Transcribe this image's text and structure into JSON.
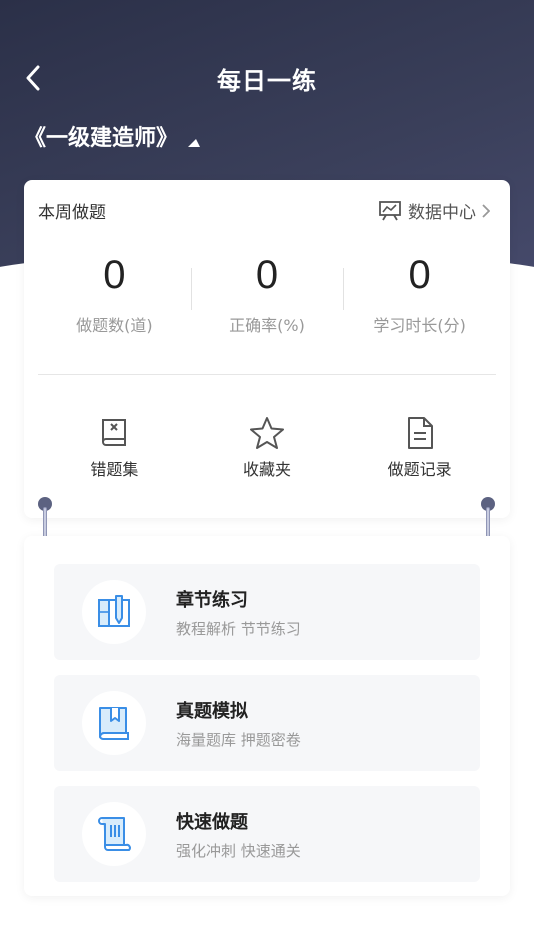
{
  "nav": {
    "title": "每日一练",
    "back_icon": "chevron-left-icon"
  },
  "exam": {
    "name": "《一级建造师》",
    "icon": "triangle-down-icon"
  },
  "weekly": {
    "title": "本周做题",
    "data_center_label": "数据中心",
    "stats": [
      {
        "value": "0",
        "label": "做题数(道)"
      },
      {
        "value": "0",
        "label": "正确率(%)"
      },
      {
        "value": "0",
        "label": "学习时长(分)"
      }
    ]
  },
  "actions": [
    {
      "label": "错题集",
      "icon": "wrong-book-icon"
    },
    {
      "label": "收藏夹",
      "icon": "star-icon"
    },
    {
      "label": "做题记录",
      "icon": "document-icon"
    }
  ],
  "practices": [
    {
      "title": "章节练习",
      "subtitle": "教程解析 节节练习",
      "icon": "chapter-pen-icon"
    },
    {
      "title": "真题模拟",
      "subtitle": "海量题库 押题密卷",
      "icon": "bookmark-book-icon"
    },
    {
      "title": "快速做题",
      "subtitle": "强化冲刺 快速通关",
      "icon": "scroll-icon"
    }
  ],
  "colors": {
    "header_dark": "#2b3048",
    "accent_blue": "#3a8ee6",
    "icon_gray": "#555555"
  }
}
